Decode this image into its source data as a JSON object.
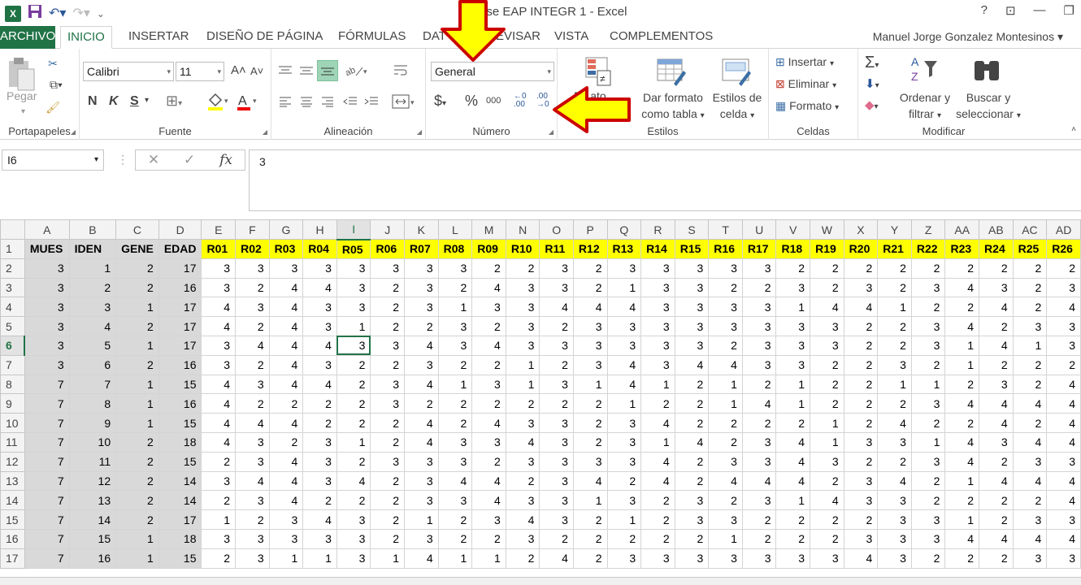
{
  "window": {
    "title": "ase EAP INTEGR 1 - Excel",
    "help": "?",
    "controls": [
      "—",
      "❐"
    ]
  },
  "tabs": {
    "file": "ARCHIVO",
    "items": [
      "INICIO",
      "INSERTAR",
      "DISEÑO DE PÁGINA",
      "FÓRMULAS",
      "DAT",
      "EVISAR",
      "VISTA",
      "COMPLEMENTOS"
    ],
    "active": "INICIO",
    "user": "Manuel Jorge Gonzalez Montesinos"
  },
  "ribbon": {
    "clipboard": {
      "label": "Portapapeles",
      "paste": "Pegar"
    },
    "font": {
      "label": "Fuente",
      "name": "Calibri",
      "size": "11",
      "bold": "N",
      "italic": "K",
      "underline": "S"
    },
    "alignment": {
      "label": "Alineación"
    },
    "number": {
      "label": "Número",
      "format": "General",
      "currency": "$",
      "percent": "%",
      "thousands": "000"
    },
    "styles": {
      "label": "Estilos",
      "cond_format": "Fo   ato",
      "format_table_1": "Dar formato",
      "format_table_2": "como tabla",
      "cell_styles_1": "Estilos de",
      "cell_styles_2": "celda"
    },
    "cells": {
      "label": "Celdas",
      "insert": "Insertar",
      "delete": "Eliminar",
      "format": "Formato"
    },
    "editing": {
      "label": "Modificar",
      "sum": "Σ",
      "sort_1": "Ordenar y",
      "sort_2": "filtrar",
      "find_1": "Buscar y",
      "find_2": "seleccionar"
    }
  },
  "formula_bar": {
    "name_box": "I6",
    "fx": "fx",
    "value": "3"
  },
  "sheet": {
    "columns": [
      "A",
      "B",
      "C",
      "D",
      "E",
      "F",
      "G",
      "H",
      "I",
      "J",
      "K",
      "L",
      "M",
      "N",
      "O",
      "P",
      "Q",
      "R",
      "S",
      "T",
      "U",
      "V",
      "W",
      "X",
      "Y",
      "Z",
      "AA",
      "AB",
      "AC",
      "AD"
    ],
    "selected_column": "I",
    "selected_row": "6",
    "headers": [
      "MUES",
      "IDEN",
      "GENE",
      "EDAD",
      "R01",
      "R02",
      "R03",
      "R04",
      "R05",
      "R06",
      "R07",
      "R08",
      "R09",
      "R10",
      "R11",
      "R12",
      "R13",
      "R14",
      "R15",
      "R16",
      "R17",
      "R18",
      "R19",
      "R20",
      "R21",
      "R22",
      "R23",
      "R24",
      "R25",
      "R26"
    ],
    "rows": [
      [
        3,
        1,
        2,
        17,
        3,
        3,
        3,
        3,
        3,
        3,
        3,
        3,
        2,
        2,
        3,
        2,
        3,
        3,
        3,
        3,
        3,
        2,
        2,
        2,
        2,
        2,
        2,
        2,
        2,
        2
      ],
      [
        3,
        2,
        2,
        16,
        3,
        2,
        4,
        4,
        3,
        2,
        3,
        2,
        4,
        3,
        3,
        2,
        1,
        3,
        3,
        2,
        2,
        3,
        2,
        3,
        2,
        3,
        4,
        3,
        2,
        3
      ],
      [
        3,
        3,
        1,
        17,
        4,
        3,
        4,
        3,
        3,
        2,
        3,
        1,
        3,
        3,
        4,
        4,
        4,
        3,
        3,
        3,
        3,
        1,
        4,
        4,
        1,
        2,
        2,
        4,
        2,
        4
      ],
      [
        3,
        4,
        2,
        17,
        4,
        2,
        4,
        3,
        1,
        2,
        2,
        3,
        2,
        3,
        2,
        3,
        3,
        3,
        3,
        3,
        3,
        3,
        3,
        2,
        2,
        3,
        4,
        2,
        3,
        3
      ],
      [
        3,
        5,
        1,
        17,
        3,
        4,
        4,
        4,
        3,
        3,
        4,
        3,
        4,
        3,
        3,
        3,
        3,
        3,
        3,
        2,
        3,
        3,
        3,
        2,
        2,
        3,
        1,
        4,
        1,
        3
      ],
      [
        3,
        6,
        2,
        16,
        3,
        2,
        4,
        3,
        2,
        2,
        3,
        2,
        2,
        1,
        2,
        3,
        4,
        3,
        4,
        4,
        3,
        3,
        2,
        2,
        3,
        2,
        1,
        2,
        2,
        2
      ],
      [
        7,
        7,
        1,
        15,
        4,
        3,
        4,
        4,
        2,
        3,
        4,
        1,
        3,
        1,
        3,
        1,
        4,
        1,
        2,
        1,
        2,
        1,
        2,
        2,
        1,
        1,
        2,
        3,
        2,
        4
      ],
      [
        7,
        8,
        1,
        16,
        4,
        2,
        2,
        2,
        2,
        3,
        2,
        2,
        2,
        2,
        2,
        2,
        1,
        2,
        2,
        1,
        4,
        1,
        2,
        2,
        2,
        3,
        4,
        4,
        4,
        4
      ],
      [
        7,
        9,
        1,
        15,
        4,
        4,
        4,
        2,
        2,
        2,
        4,
        2,
        4,
        3,
        3,
        2,
        3,
        4,
        2,
        2,
        2,
        2,
        1,
        2,
        4,
        2,
        2,
        4,
        2,
        4
      ],
      [
        7,
        10,
        2,
        18,
        4,
        3,
        2,
        3,
        1,
        2,
        4,
        3,
        3,
        4,
        3,
        2,
        3,
        1,
        4,
        2,
        3,
        4,
        1,
        3,
        3,
        1,
        4,
        3,
        4,
        4
      ],
      [
        7,
        11,
        2,
        15,
        2,
        3,
        4,
        3,
        2,
        3,
        3,
        3,
        2,
        3,
        3,
        3,
        3,
        4,
        2,
        3,
        3,
        4,
        3,
        2,
        2,
        3,
        4,
        2,
        3,
        3
      ],
      [
        7,
        12,
        2,
        14,
        3,
        4,
        4,
        3,
        4,
        2,
        3,
        4,
        4,
        2,
        3,
        4,
        2,
        4,
        2,
        4,
        4,
        4,
        2,
        3,
        4,
        2,
        1,
        4,
        4,
        4
      ],
      [
        7,
        13,
        2,
        14,
        2,
        3,
        4,
        2,
        2,
        2,
        3,
        3,
        4,
        3,
        3,
        1,
        3,
        2,
        3,
        2,
        3,
        1,
        4,
        3,
        3,
        2,
        2,
        2,
        2,
        4
      ],
      [
        7,
        14,
        2,
        17,
        1,
        2,
        3,
        4,
        3,
        2,
        1,
        2,
        3,
        4,
        3,
        2,
        1,
        2,
        3,
        3,
        2,
        2,
        2,
        2,
        3,
        3,
        1,
        2,
        3,
        3
      ],
      [
        7,
        15,
        1,
        18,
        3,
        3,
        3,
        3,
        3,
        2,
        3,
        2,
        2,
        3,
        2,
        2,
        2,
        2,
        2,
        1,
        2,
        2,
        2,
        3,
        3,
        3,
        4,
        4,
        4,
        4
      ],
      [
        7,
        16,
        1,
        15,
        2,
        3,
        1,
        1,
        3,
        1,
        4,
        1,
        1,
        2,
        4,
        2,
        3,
        3,
        3,
        3,
        3,
        3,
        3,
        4,
        3,
        2,
        2,
        2,
        3,
        3
      ]
    ]
  },
  "icons": {
    "copy": "copy-icon",
    "cut": "scissors-icon",
    "brush": "format-painter-icon"
  },
  "colors": {
    "accent": "#217346",
    "header_fill": "#ffff00",
    "id_fill": "#d9d9d9",
    "arrow": "#ffff00"
  }
}
